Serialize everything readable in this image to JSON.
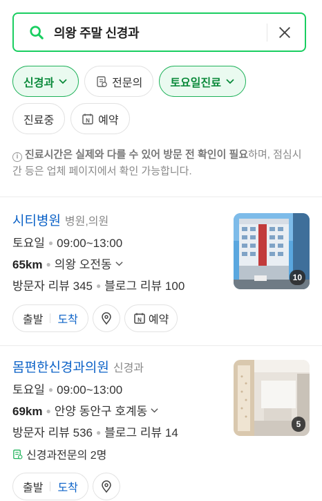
{
  "search": {
    "query": "의왕 주말 신경과",
    "icon": "search-icon",
    "clear_icon": "close-icon"
  },
  "filters": {
    "row1": [
      {
        "label": "신경과",
        "active": true,
        "has_dropdown": true
      },
      {
        "label": "전문의",
        "active": false,
        "icon": "specialist-icon"
      },
      {
        "label": "토요일진료",
        "active": true,
        "has_dropdown": true
      }
    ],
    "row2": [
      {
        "label": "진료중",
        "active": false
      },
      {
        "label": "예약",
        "active": false,
        "icon": "naver-booking-icon"
      }
    ]
  },
  "notice": {
    "bold": "진료시간은 실제와 다를 수 있어 방문 전 확인이 필요",
    "rest": "하며, 점심시간 등은 업체 페이지에서 확인 가능합니다."
  },
  "results": [
    {
      "name": "시티병원",
      "category": "병원,의원",
      "day": "토요일",
      "hours": "09:00~13:00",
      "distance": "65km",
      "area": "의왕 오전동",
      "visitor_reviews": "방문자 리뷰 345",
      "blog_reviews": "블로그 리뷰 100",
      "photo_count": "10",
      "actions": {
        "depart": "출발",
        "arrive": "도착",
        "booking": "예약"
      }
    },
    {
      "name": "몸편한신경과의원",
      "category": "신경과",
      "day": "토요일",
      "hours": "09:00~13:00",
      "distance": "69km",
      "area": "안양 동안구 호계동",
      "visitor_reviews": "방문자 리뷰 536",
      "blog_reviews": "블로그 리뷰 14",
      "specialists": "신경과전문의 2명",
      "photo_count": "5",
      "actions": {
        "depart": "출발",
        "arrive": "도착"
      }
    }
  ],
  "colors": {
    "brand_green": "#19ce60",
    "link_blue": "#0a61c7"
  }
}
